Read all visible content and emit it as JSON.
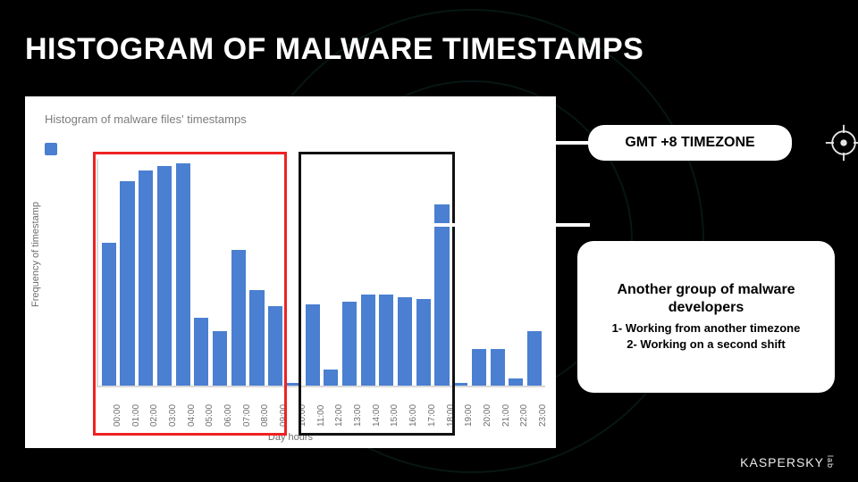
{
  "title": "HISTOGRAM OF MALWARE TIMESTAMPS",
  "callouts": {
    "a": {
      "title": "GMT +8 TIMEZONE"
    },
    "b": {
      "title": "Another group of malware developers",
      "line1": "1- Working from another timezone",
      "line2": "2- Working on a second shift"
    }
  },
  "brand": {
    "name": "KASPERSKY",
    "suffix": "lab"
  },
  "chart_data": {
    "type": "bar",
    "title": "Histogram of malware files' timestamps",
    "xlabel": "Day hours",
    "ylabel": "Frequency of timestamp",
    "categories": [
      "00:00",
      "01:00",
      "02:00",
      "03:00",
      "04:00",
      "05:00",
      "06:00",
      "07:00",
      "08:00",
      "09:00",
      "10:00",
      "11:00",
      "12:00",
      "13:00",
      "14:00",
      "15:00",
      "16:00",
      "17:00",
      "18:00",
      "19:00",
      "20:00",
      "21:00",
      "22:00",
      "23:00"
    ],
    "values": [
      63,
      90,
      95,
      97,
      98,
      30,
      24,
      60,
      42,
      35,
      1,
      36,
      7,
      37,
      40,
      40,
      39,
      38,
      80,
      1,
      16,
      16,
      3,
      24
    ],
    "ylim": [
      0,
      100
    ],
    "highlights": [
      {
        "style": "red",
        "from_index": 0,
        "to_index": 9
      },
      {
        "style": "black",
        "from_index": 11,
        "to_index": 18
      }
    ]
  }
}
